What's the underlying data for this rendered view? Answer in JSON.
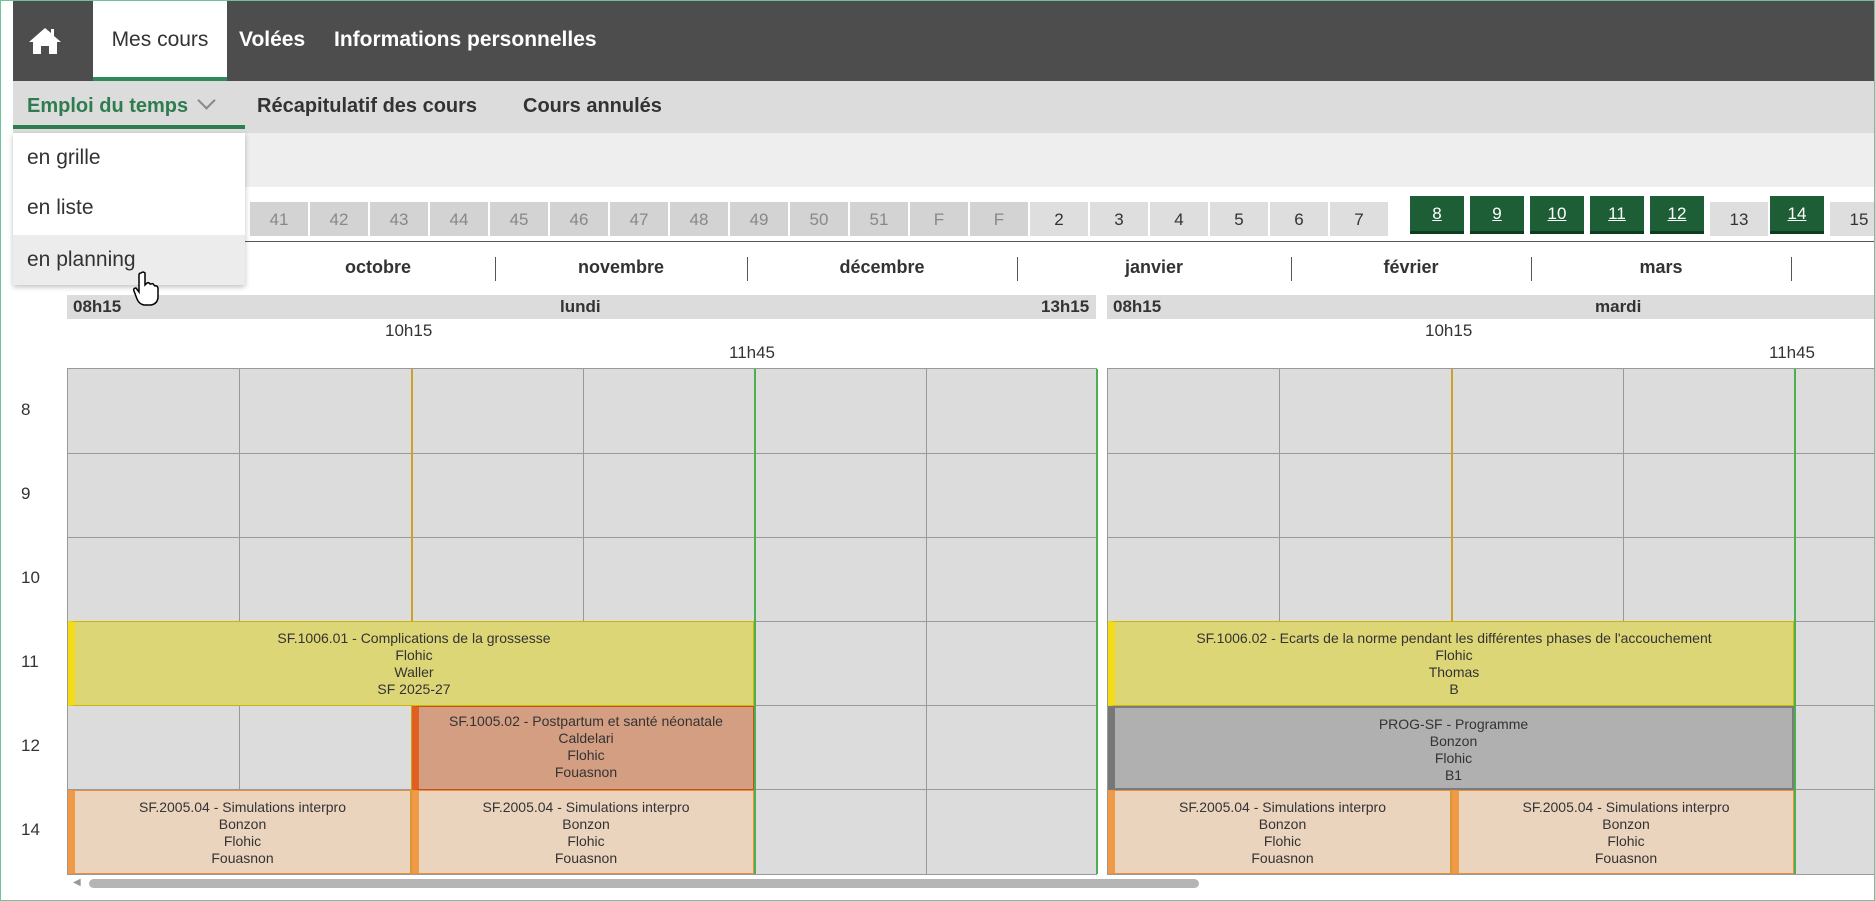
{
  "topnav": {
    "tabs": [
      "Mes cours",
      "Volées",
      "Informations personnelles"
    ]
  },
  "subnav": {
    "tabs": [
      "Emploi du temps",
      "Récapitulatif des cours",
      "Cours annulés"
    ]
  },
  "dropdown": {
    "items": [
      "en grille",
      "en liste",
      "en planning"
    ]
  },
  "weeks": [
    {
      "label": "41",
      "state": "grey"
    },
    {
      "label": "42",
      "state": "grey"
    },
    {
      "label": "43",
      "state": "grey"
    },
    {
      "label": "44",
      "state": "grey"
    },
    {
      "label": "45",
      "state": "grey"
    },
    {
      "label": "46",
      "state": "grey"
    },
    {
      "label": "47",
      "state": "grey"
    },
    {
      "label": "48",
      "state": "grey"
    },
    {
      "label": "49",
      "state": "grey"
    },
    {
      "label": "50",
      "state": "grey"
    },
    {
      "label": "51",
      "state": "grey"
    },
    {
      "label": "F",
      "state": "grey"
    },
    {
      "label": "F",
      "state": "grey"
    },
    {
      "label": "2",
      "state": "norm"
    },
    {
      "label": "3",
      "state": "norm"
    },
    {
      "label": "4",
      "state": "norm"
    },
    {
      "label": "5",
      "state": "norm"
    },
    {
      "label": "6",
      "state": "norm"
    },
    {
      "label": "7",
      "state": "norm"
    },
    {
      "label": "8",
      "state": "green"
    },
    {
      "label": "9",
      "state": "green"
    },
    {
      "label": "10",
      "state": "green"
    },
    {
      "label": "11",
      "state": "green"
    },
    {
      "label": "12",
      "state": "green"
    },
    {
      "label": "13",
      "state": "norm"
    },
    {
      "label": "14",
      "state": "green"
    },
    {
      "label": "15",
      "state": "norm"
    }
  ],
  "months": [
    "octobre",
    "novembre",
    "décembre",
    "janvier",
    "février",
    "mars"
  ],
  "days": [
    {
      "name": "lundi",
      "start": "08h15",
      "end": "13h15",
      "t1": "10h15",
      "t2": "11h45"
    },
    {
      "name": "mardi",
      "start": "08h15",
      "t1": "10h15",
      "t2": "11h45"
    }
  ],
  "rows": [
    "8",
    "9",
    "10",
    "11",
    "12",
    "14"
  ],
  "events": {
    "mon_11": [
      "SF.1006.01 - Complications de la grossesse",
      "Flohic",
      "Waller",
      "SF 2025-27"
    ],
    "mon_12": [
      "SF.1005.02 - Postpartum et santé néonatale",
      "Caldelari",
      "Flohic",
      "Fouasnon"
    ],
    "mon_14a": [
      "SF.2005.04 - Simulations interpro",
      "Bonzon",
      "Flohic",
      "Fouasnon"
    ],
    "mon_14b": [
      "SF.2005.04 - Simulations interpro",
      "Bonzon",
      "Flohic",
      "Fouasnon"
    ],
    "tue_11": [
      "SF.1006.02 - Ecarts de la norme pendant les différentes phases de l'accouchement",
      "Flohic",
      "Thomas",
      "B"
    ],
    "tue_12": [
      "PROG-SF - Programme",
      "Bonzon",
      "Flohic",
      "B1"
    ],
    "tue_14a": [
      "SF.2005.04 - Simulations interpro",
      "Bonzon",
      "Flohic",
      "Fouasnon"
    ],
    "tue_14b": [
      "SF.2005.04 - Simulations interpro",
      "Bonzon",
      "Flohic",
      "Fouasnon"
    ]
  },
  "colors": {
    "nav": "#4d4d4d",
    "accent": "#2e7d4f",
    "week_active": "#1e5e36"
  }
}
